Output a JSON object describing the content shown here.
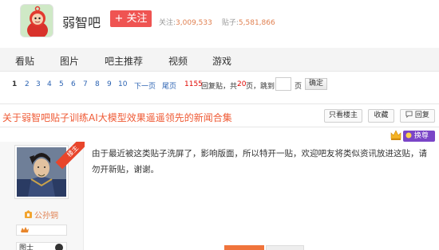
{
  "header": {
    "forum_name": "弱智吧",
    "follow_label": "+ 关注",
    "follow_count_label": "关注:",
    "follow_count": "3,009,533",
    "post_count_label": "贴子:",
    "post_count": "5,581,866"
  },
  "nav": {
    "items": [
      {
        "label": "看贴"
      },
      {
        "label": "图片"
      },
      {
        "label": "吧主推荐"
      },
      {
        "label": "视频"
      },
      {
        "label": "游戏"
      }
    ]
  },
  "pager": {
    "pages": [
      "1",
      "2",
      "3",
      "4",
      "5",
      "6",
      "7",
      "8",
      "9",
      "10"
    ],
    "next_label": "下一页",
    "last_label": "尾页",
    "reply_count": "1155",
    "reply_suffix": "回复贴，共",
    "page_total": "20",
    "page_suffix": "页，",
    "jump_label": "跳到",
    "page_unit": "页",
    "ok_label": "确定"
  },
  "thread": {
    "title": "关于弱智吧贴子训练AI大模型效果遥遥领先的新闻合集",
    "only_op_label": "只看楼主",
    "collect_label": "收藏",
    "reply_label": "回复"
  },
  "badge": {
    "exchange_label": "换尊"
  },
  "post": {
    "ribbon_label": "楼主",
    "username": "公孙铜",
    "content": "由于最近被这类贴子洗屏了，影响版面，所以特开一贴，欢迎吧友将类似资讯放进这贴，请勿开新贴，谢谢。",
    "second_row_text": "图士"
  },
  "colors": {
    "accent_red": "#ef5452",
    "title_orange": "#ef5a35",
    "link_blue": "#2d64b3",
    "exchange_purple": "#7a45c7"
  }
}
